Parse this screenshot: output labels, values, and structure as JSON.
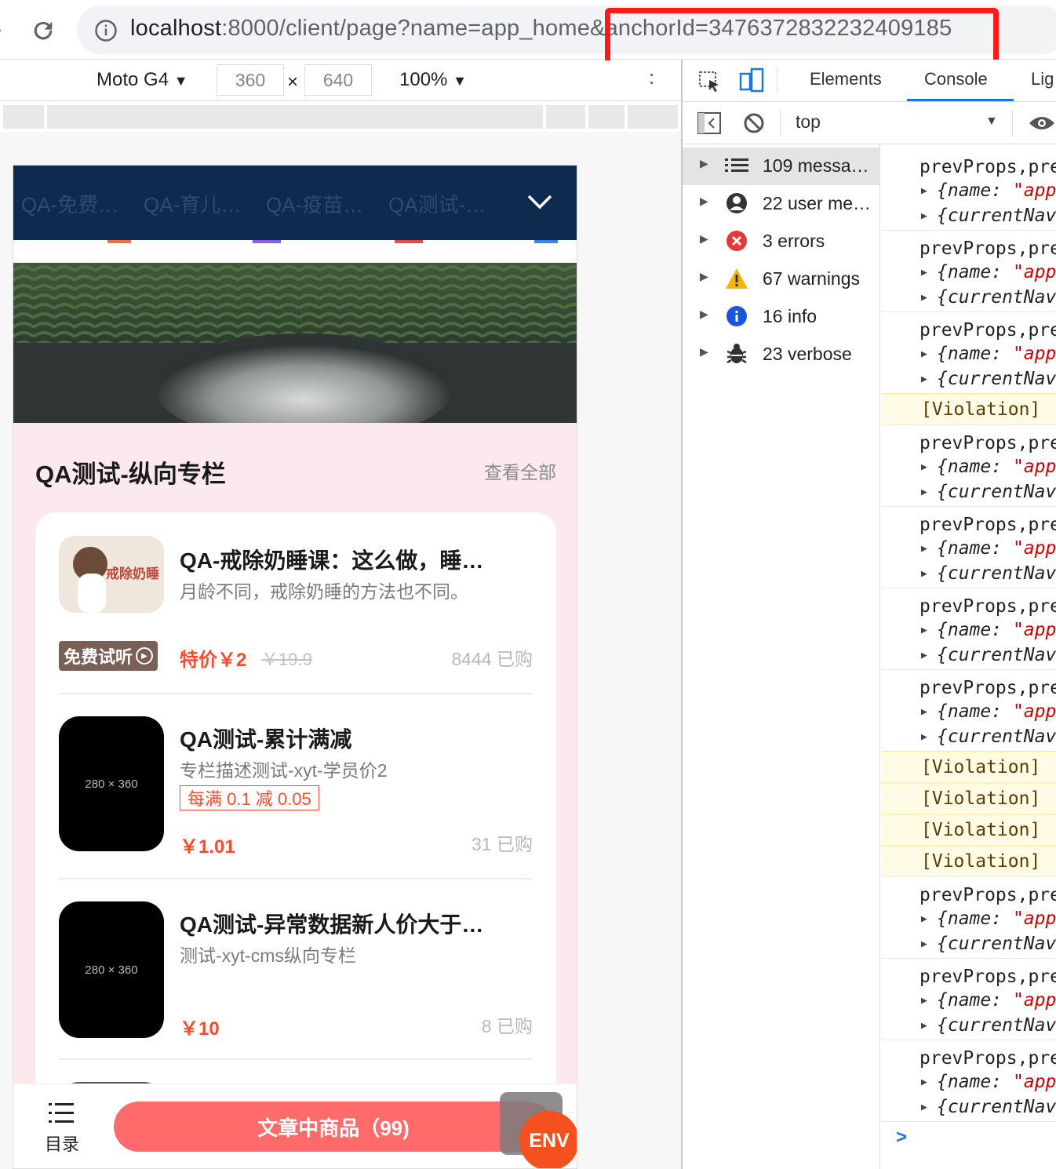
{
  "browser": {
    "url_host": "localhost",
    "url_rest": ":8000/client/page?name=app_home&anchorId=3476372832232409185"
  },
  "device_toolbar": {
    "device": "Moto G4",
    "width": "360",
    "height": "640",
    "times": "×",
    "zoom": "100%"
  },
  "page": {
    "nav_tabs": [
      "QA-免费…",
      "QA-育儿…",
      "QA-疫苗…",
      "QA测试-…"
    ],
    "section_title": "QA测试-纵向专栏",
    "view_all": "查看全部",
    "products": [
      {
        "title": "QA-戒除奶睡课：这么做，睡…",
        "desc": "月龄不同，戒除奶睡的方法也不同。",
        "trial_badge": "免费试听",
        "price_label": "特价￥2",
        "original_price": "￥19.9",
        "sold": "8444 已购",
        "thumb_text": "戒除奶睡"
      },
      {
        "title": "QA测试-累计满减",
        "desc": "专栏描述测试-xyt-学员价2",
        "promo": "每满 0.1 减 0.05",
        "price_label": "￥1.01",
        "sold": "31 已购",
        "thumb_text": "280 × 360"
      },
      {
        "title": "QA测试-异常数据新人价大于…",
        "desc": "测试-xyt-cms纵向专栏",
        "price_label": "￥10",
        "sold": "8 已购",
        "thumb_text": "280 × 360"
      }
    ],
    "bottom": {
      "catalog": "目录",
      "button": "文章中商品（99)",
      "env": "ENV"
    }
  },
  "devtools": {
    "tabs": [
      "Elements",
      "Console",
      "Lig"
    ],
    "context": "top",
    "sidebar": [
      {
        "label": "109 messa…",
        "icon": "list-icon"
      },
      {
        "label": "22 user me…",
        "icon": "user-icon"
      },
      {
        "label": "3 errors",
        "icon": "error-icon",
        "color": "#e53935"
      },
      {
        "label": "67 warnings",
        "icon": "warning-icon",
        "color": "#f4b400"
      },
      {
        "label": "16 info",
        "icon": "info-icon",
        "color": "#1a56db"
      },
      {
        "label": "23 verbose",
        "icon": "bug-icon"
      }
    ],
    "log_line1": "prevProps,pre",
    "log_line2_key": "{name: ",
    "log_line2_val": "\"app",
    "log_line3": "{currentNav",
    "violation": "[Violation]",
    "prompt": ">"
  }
}
